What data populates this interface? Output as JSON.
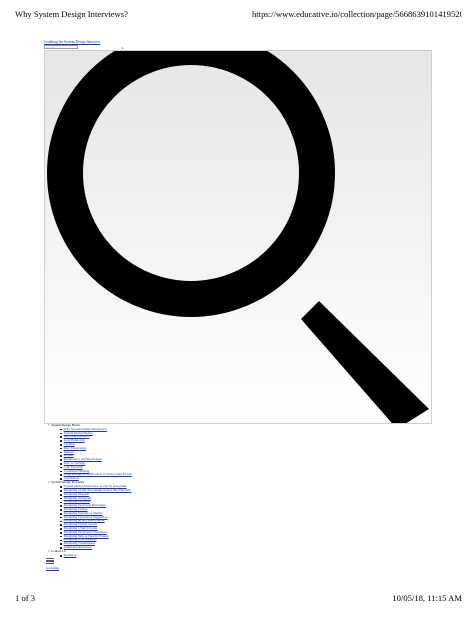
{
  "print_header": {
    "title": "Why System Design Interviews?",
    "url": "https://www.educative.io/collection/page/5668639101419520..."
  },
  "page": {
    "top_link": "Grokking the System Design Interview",
    "search_placeholder": "Search",
    "search_button": "»"
  },
  "icon_box": {
    "icon": "magnifier-icon",
    "color": "#000000"
  },
  "nav": {
    "sections": [
      {
        "title": "System Design Basics",
        "items": [
          "Why System Design Interviews?",
          "System Design Basics",
          "Key Characteristics",
          "Load Balancing",
          "Caching",
          "Data Partitioning",
          "Indexes",
          "Proxies",
          "Redundancy and Replication",
          "SQL vs. NoSQL",
          "CAP Theorem",
          "Consistent Hashing",
          "Long-Polling vs WebSockets vs Server-Sent Events",
          "Conclusion"
        ]
      },
      {
        "title": "System Design Problems",
        "items": [
          "System Design Interviews: A step by step guide",
          "Designing a URL Shortening service like TinyURL",
          "Designing Pastebin",
          "Designing Instagram",
          "Designing Dropbox",
          "Designing Facebook Messenger",
          "Designing Twitter",
          "Designing Youtube or Netflix",
          "Designing Typeahead Suggestion",
          "Designing an API Rate Limiter",
          "Designing Twitter Search",
          "Designing a Web Crawler",
          "Designing Facebook's Newsfeed",
          "Designing Yelp or Nearby Friends",
          "Designing Uber backend",
          "Designing Ticketmaster",
          "Additional Resources"
        ]
      },
      {
        "title": "Contact Us",
        "items": [
          "Feedback"
        ]
      }
    ]
  },
  "bottom_link": "Grokking",
  "print_footer": {
    "page_count": "1 of 3",
    "timestamp": "10/05/18, 11:15 AM"
  }
}
